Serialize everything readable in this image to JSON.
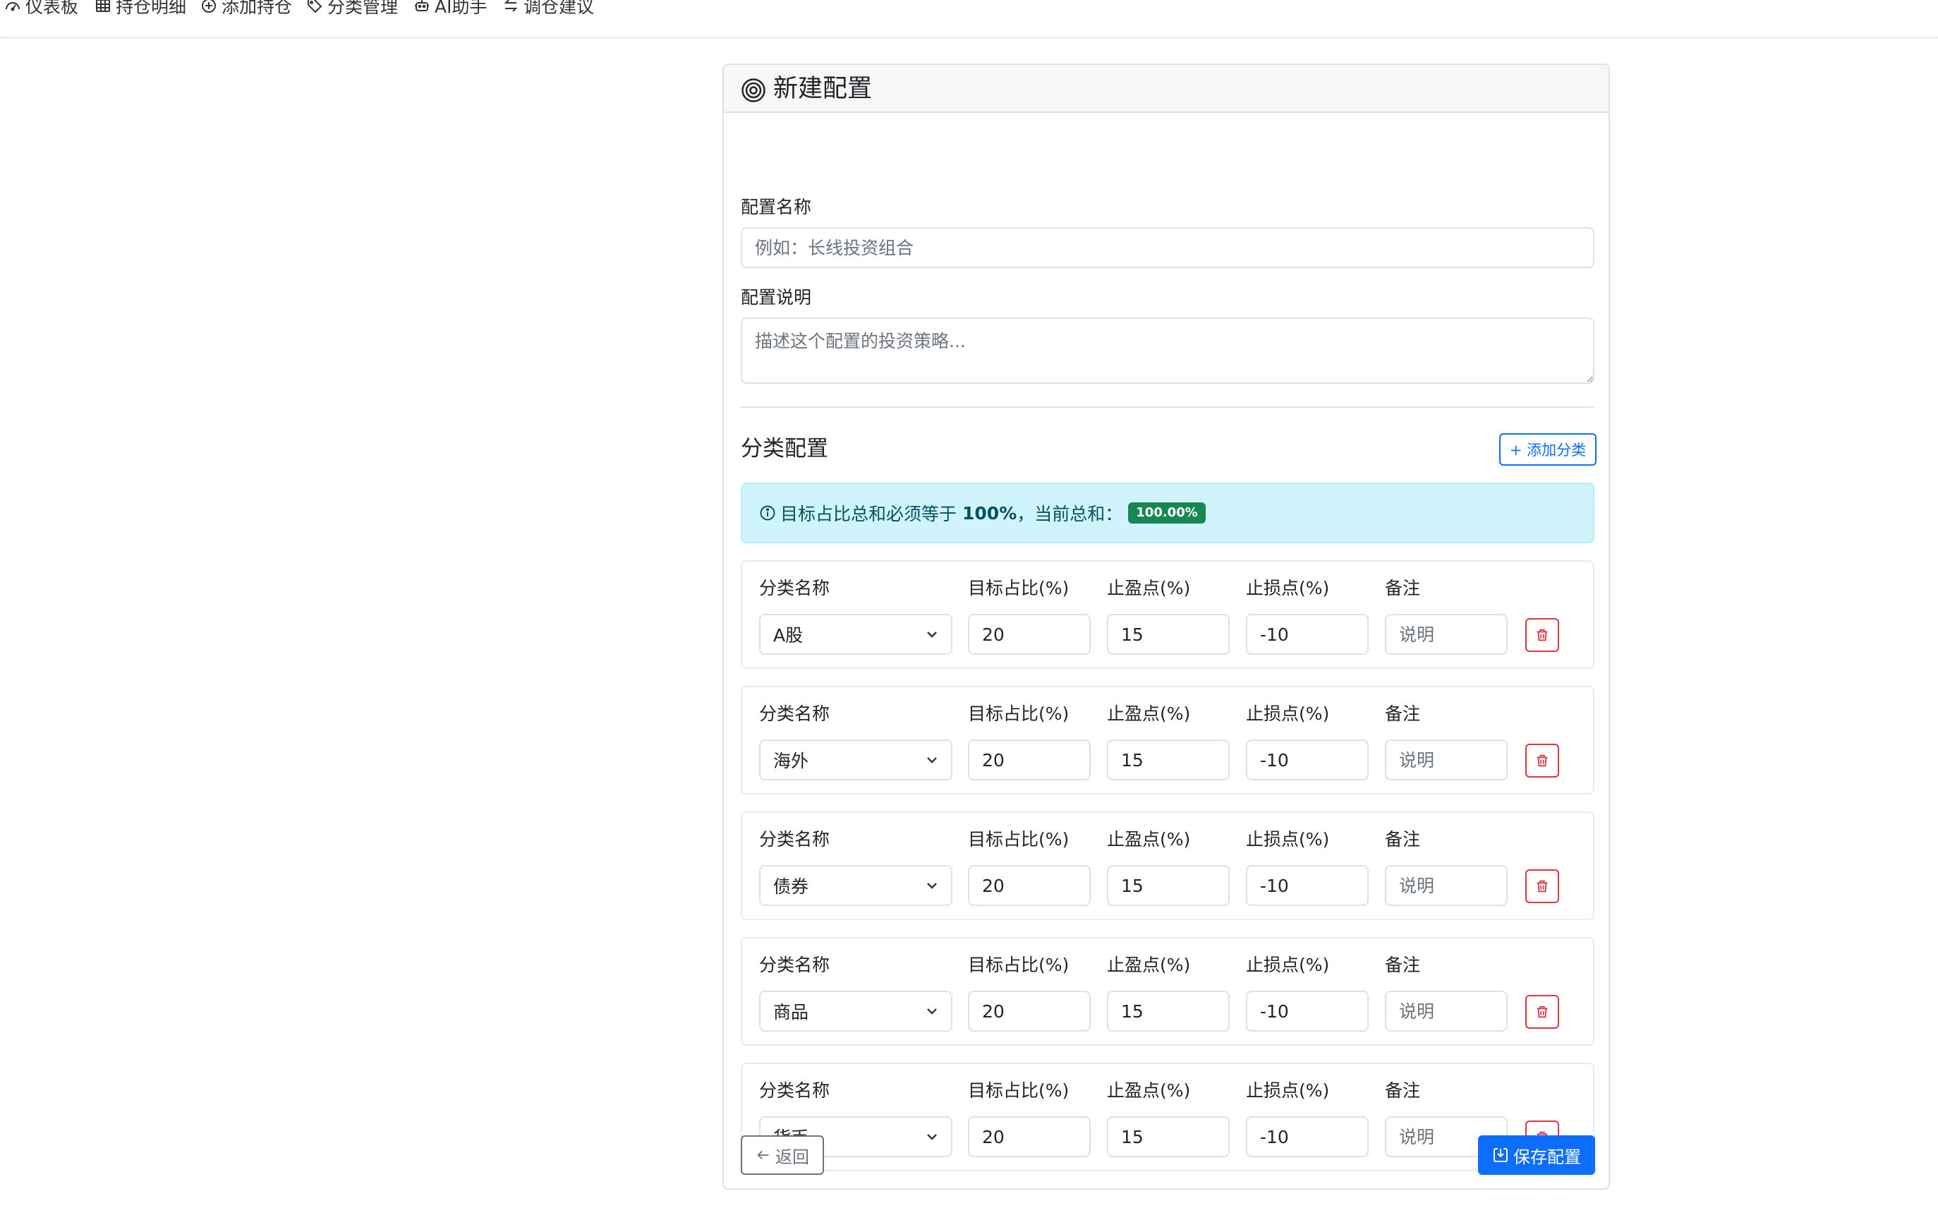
{
  "nav": {
    "items": [
      {
        "label": "仪表板",
        "icon": "speedometer-icon"
      },
      {
        "label": "持仓明细",
        "icon": "table-icon"
      },
      {
        "label": "添加持仓",
        "icon": "plus-circle-icon"
      },
      {
        "label": "分类管理",
        "icon": "tags-icon"
      },
      {
        "label": "AI助手",
        "icon": "robot-icon"
      },
      {
        "label": "调仓建议",
        "icon": "arrow-left-right-icon"
      }
    ]
  },
  "card": {
    "title": "新建配置",
    "title_icon": "bullseye-icon"
  },
  "form": {
    "name_label": "配置名称",
    "name_placeholder": "例如：长线投资组合",
    "name_value": "",
    "desc_label": "配置说明",
    "desc_placeholder": "描述这个配置的投资策略...",
    "desc_value": ""
  },
  "categories": {
    "title": "分类配置",
    "add_button": "+ 添加分类",
    "alert_prefix": "目标占比总和必须等于",
    "alert_required": "100%",
    "alert_suffix": "，当前总和：",
    "alert_total": "100.00%",
    "columns": {
      "name": "分类名称",
      "target": "目标占比(%)",
      "take_profit": "止盈点(%)",
      "stop_loss": "止损点(%)",
      "note": "备注"
    },
    "note_placeholder": "说明",
    "rows": [
      {
        "name": "A股",
        "target": "20",
        "take_profit": "15",
        "stop_loss": "-10",
        "note": ""
      },
      {
        "name": "海外",
        "target": "20",
        "take_profit": "15",
        "stop_loss": "-10",
        "note": ""
      },
      {
        "name": "债券",
        "target": "20",
        "take_profit": "15",
        "stop_loss": "-10",
        "note": ""
      },
      {
        "name": "商品",
        "target": "20",
        "take_profit": "15",
        "stop_loss": "-10",
        "note": ""
      },
      {
        "name": "货币",
        "target": "20",
        "take_profit": "15",
        "stop_loss": "-10",
        "note": ""
      }
    ]
  },
  "actions": {
    "back": "返回",
    "save": "保存配置"
  },
  "colors": {
    "primary": "#0d6efd",
    "danger": "#dc3545",
    "success": "#198754",
    "info_bg": "#cff4fc",
    "info_text": "#055160"
  }
}
